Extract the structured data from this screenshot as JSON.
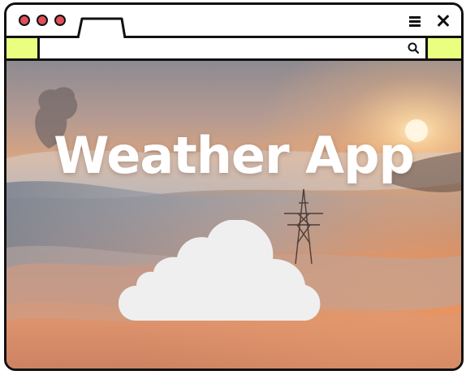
{
  "browser": {
    "window_controls": {
      "close_color": "#e0505a",
      "minimize_color": "#e0505a",
      "maximize_color": "#e0505a"
    },
    "tab": {
      "label": ""
    },
    "address_bar": {
      "value": "",
      "placeholder": "",
      "accent_color": "#eaff80"
    },
    "icons": [
      "menu-icon",
      "close-icon",
      "search-icon"
    ]
  },
  "page": {
    "title": "Weather App",
    "hero_icon": "cloud-icon"
  }
}
